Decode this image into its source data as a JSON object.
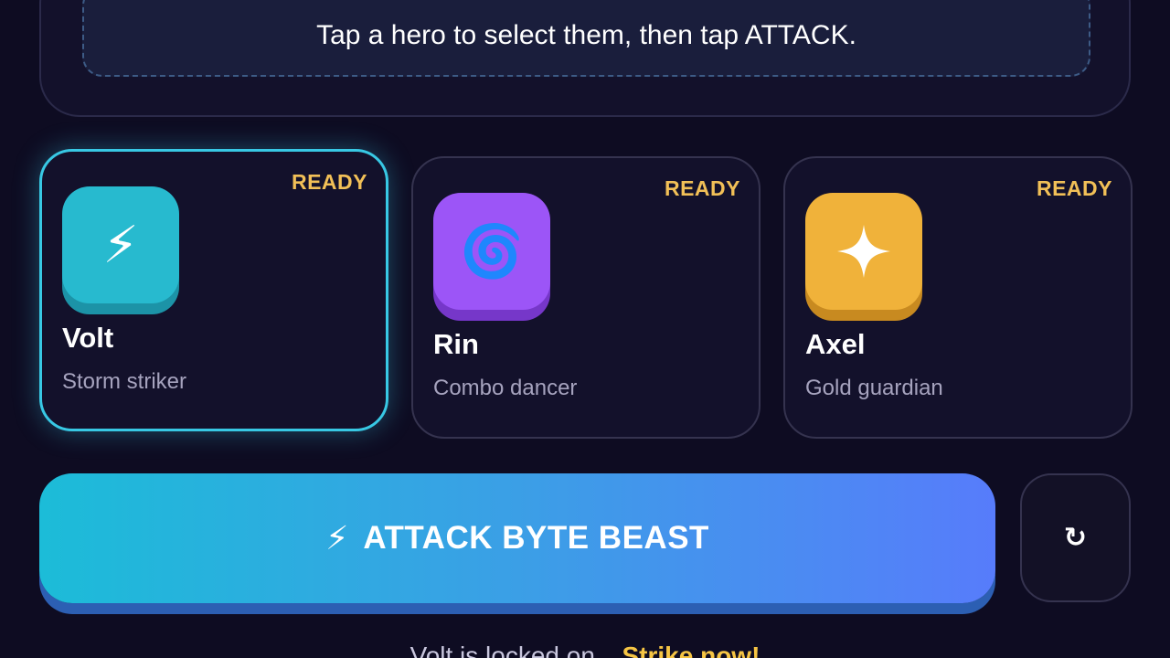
{
  "hint": {
    "text": "Tap a hero to select them, then tap ATTACK."
  },
  "heroes": [
    {
      "name": "Volt",
      "role": "Storm striker",
      "status": "READY",
      "icon": "lightning-icon",
      "glyph": "⚡",
      "color": "#27bacf",
      "selected": true
    },
    {
      "name": "Rin",
      "role": "Combo dancer",
      "status": "READY",
      "icon": "spiral-icon",
      "glyph": "🌀",
      "color": "#9c55f7",
      "selected": false
    },
    {
      "name": "Axel",
      "role": "Gold guardian",
      "status": "READY",
      "icon": "sparkle-icon",
      "glyph": "✦",
      "color": "#f0b23a",
      "selected": false
    }
  ],
  "attack": {
    "icon": "lightning-icon",
    "glyph": "⚡",
    "label": "ATTACK BYTE BEAST"
  },
  "reset": {
    "icon": "refresh-icon",
    "glyph": "↻"
  },
  "status": {
    "message": "Volt is locked on.",
    "cta": "Strike now!"
  },
  "colors": {
    "background": "#0e0c22",
    "accent": "#38c8e4",
    "ready": "#f2c057",
    "cta": "#f6c544"
  }
}
